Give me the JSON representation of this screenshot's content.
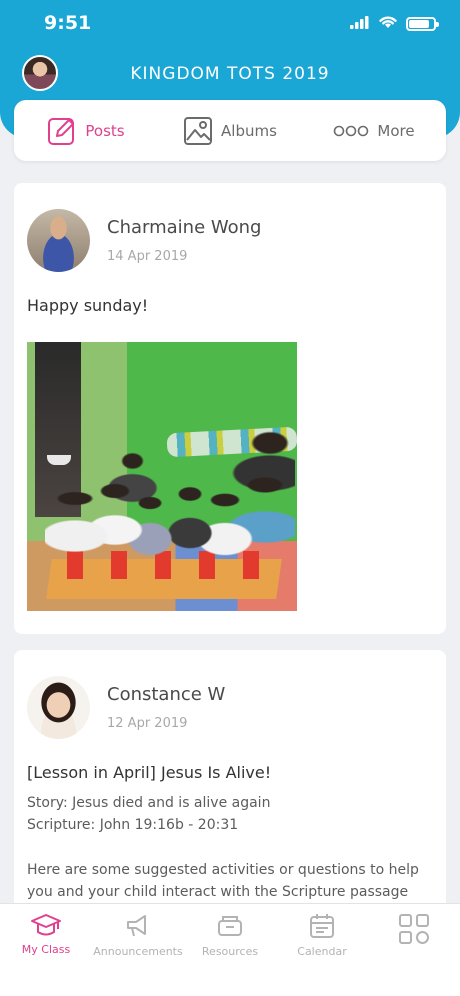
{
  "status_bar": {
    "time": "9:51",
    "battery_level": 0.85
  },
  "header": {
    "title": "KINGDOM TOTS 2019"
  },
  "tabs": [
    {
      "label": "Posts",
      "icon": "edit-icon",
      "active": true
    },
    {
      "label": "Albums",
      "icon": "image-icon",
      "active": false
    },
    {
      "label": "More",
      "icon": "more-dots-icon",
      "active": false
    }
  ],
  "posts": [
    {
      "author": "Charmaine Wong",
      "date": "14 Apr 2019",
      "text": "Happy sunday!"
    },
    {
      "author": "Constance W",
      "date": "12 Apr 2019",
      "title": "[Lesson in April] Jesus Is Alive!",
      "lines": [
        "Story: Jesus died and is alive again",
        "Scripture: John 19:16b - 20:31",
        "Here are some suggested activities or questions to help",
        "you and your child interact with the Scripture passage"
      ]
    }
  ],
  "bottom_nav": [
    {
      "label": "My Class",
      "icon": "graduation-cap-icon",
      "active": true
    },
    {
      "label": "Announcements",
      "icon": "megaphone-icon",
      "active": false
    },
    {
      "label": "Resources",
      "icon": "resources-icon",
      "active": false
    },
    {
      "label": "Calendar",
      "icon": "calendar-icon",
      "active": false
    },
    {
      "label": "",
      "icon": "grid-icon",
      "active": false
    }
  ],
  "colors": {
    "header": "#1ba7d6",
    "accent": "#e0408f",
    "background": "#eef0f3"
  }
}
